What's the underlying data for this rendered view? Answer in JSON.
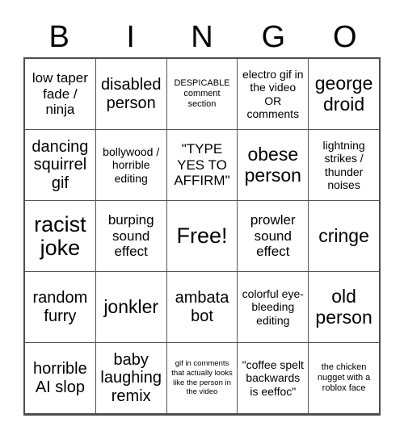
{
  "card": {
    "title": "BINGO card",
    "header_letters": [
      "B",
      "I",
      "N",
      "G",
      "O"
    ],
    "grid_size": 5,
    "colors": {
      "background": "#ffffff",
      "text": "#000000",
      "border": "#555555"
    },
    "rows": [
      [
        {
          "text": "low taper fade / ninja",
          "size": "md",
          "free": false
        },
        {
          "text": "disabled person",
          "size": "lg",
          "free": false
        },
        {
          "text": "DESPICABLE comment section",
          "size": "xs",
          "free": false
        },
        {
          "text": "electro gif in the video OR comments",
          "size": "sm",
          "free": false
        },
        {
          "text": "george droid",
          "size": "xl",
          "free": false
        }
      ],
      [
        {
          "text": "dancing squirrel gif",
          "size": "lg",
          "free": false
        },
        {
          "text": "bollywood / horrible editing",
          "size": "sm",
          "free": false
        },
        {
          "text": "\"TYPE YES TO AFFIRM\"",
          "size": "md",
          "free": false
        },
        {
          "text": "obese person",
          "size": "xl",
          "free": false
        },
        {
          "text": "lightning strikes / thunder noises",
          "size": "sm",
          "free": false
        }
      ],
      [
        {
          "text": "racist joke",
          "size": "xxl",
          "free": false
        },
        {
          "text": "burping sound effect",
          "size": "md",
          "free": false
        },
        {
          "text": "Free!",
          "size": "xxl",
          "free": true
        },
        {
          "text": "prowler sound effect",
          "size": "md",
          "free": false
        },
        {
          "text": "cringe",
          "size": "xl",
          "free": false
        }
      ],
      [
        {
          "text": "random furry",
          "size": "lg",
          "free": false
        },
        {
          "text": "jonkler",
          "size": "xl",
          "free": false
        },
        {
          "text": "ambata bot",
          "size": "lg",
          "free": false
        },
        {
          "text": "colorful eye-bleeding editing",
          "size": "sm",
          "free": false
        },
        {
          "text": "old person",
          "size": "xl",
          "free": false
        }
      ],
      [
        {
          "text": "horrible AI slop",
          "size": "lg",
          "free": false
        },
        {
          "text": "baby laughing remix",
          "size": "lg",
          "free": false
        },
        {
          "text": "gif in comments that actually looks like the person in the video",
          "size": "xxs",
          "free": false
        },
        {
          "text": "\"coffee spelt backwards is eeffoc\"",
          "size": "sm",
          "free": false
        },
        {
          "text": "the chicken nugget with a roblox face",
          "size": "xs",
          "free": false
        }
      ]
    ]
  }
}
